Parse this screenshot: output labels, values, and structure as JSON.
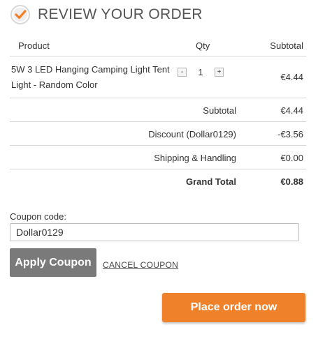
{
  "header": {
    "title": "REVIEW YOUR ORDER",
    "icon": "check-circle-icon",
    "accent_color": "#f0812b"
  },
  "table": {
    "columns": {
      "product": "Product",
      "qty": "Qty",
      "subtotal": "Subtotal"
    },
    "items": [
      {
        "name": "5W 3 LED Hanging Camping Light Tent Light - Random Color",
        "qty": "1",
        "qty_minus": "-",
        "qty_plus": "+",
        "price": "€4.44"
      }
    ],
    "totals": [
      {
        "label": "Subtotal",
        "value": "€4.44"
      },
      {
        "label": "Discount (Dollar0129)",
        "value": "-€3.56"
      },
      {
        "label": "Shipping & Handling",
        "value": "€0.00"
      },
      {
        "label": "Grand Total",
        "value": "€0.88"
      }
    ]
  },
  "coupon": {
    "label": "Coupon code:",
    "value": "Dollar0129",
    "apply_label": "Apply Coupon",
    "cancel_label": "CANCEL COUPON"
  },
  "actions": {
    "place_order_label": "Place order now",
    "place_order_color": "#f0812b",
    "apply_color": "#7a7a7a"
  }
}
